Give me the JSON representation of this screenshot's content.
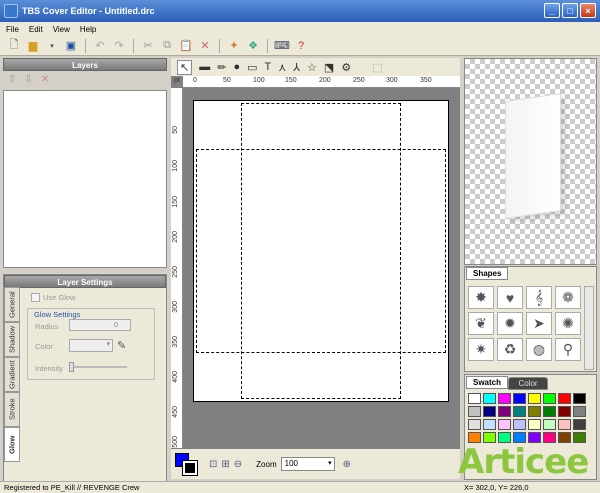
{
  "window": {
    "title": "TBS Cover Editor - Untitled.drc"
  },
  "menu": [
    "File",
    "Edit",
    "View",
    "Help"
  ],
  "layers": {
    "header": "Layers"
  },
  "layer_settings": {
    "header": "Layer Settings",
    "use_glow": "Use Glow",
    "glow_settings": "Glow Settings",
    "radius_label": "Radius",
    "radius_value": "0",
    "color_label": "Color",
    "intensity_label": "Intensity",
    "tabs": [
      "General",
      "Shadow",
      "Gradient",
      "Stroke",
      "Glow"
    ]
  },
  "ruler": {
    "h_unit": "pt",
    "h_ticks": [
      "0",
      "50",
      "100",
      "150",
      "200",
      "250",
      "300",
      "350"
    ],
    "v_ticks": [
      "50",
      "100",
      "150",
      "200",
      "250",
      "300",
      "350",
      "400",
      "450",
      "500"
    ]
  },
  "zoom": {
    "label": "Zoom",
    "value": "100"
  },
  "shapes": {
    "tab": "Shapes"
  },
  "swatch": {
    "tab": "Swatch",
    "tab2": "Color",
    "colors": [
      "#ffffff",
      "#00ffff",
      "#ff00ff",
      "#0000ff",
      "#ffff00",
      "#00ff00",
      "#ff0000",
      "#000000",
      "#c0c0c0",
      "#000080",
      "#800080",
      "#008080",
      "#808000",
      "#008000",
      "#800000",
      "#808080",
      "#e0e0e0",
      "#c0e0ff",
      "#ffc0ff",
      "#c0c0ff",
      "#ffffc0",
      "#c0ffc0",
      "#ffc0c0",
      "#404040",
      "#ff8000",
      "#80ff00",
      "#00ff80",
      "#0080ff",
      "#8000ff",
      "#ff0080",
      "#804000",
      "#408000"
    ]
  },
  "status": {
    "left": "Registered to PE_Kill // REVENGE Crew",
    "coords": "X= 302,0, Y= 226,0"
  },
  "watermark": "Articee"
}
